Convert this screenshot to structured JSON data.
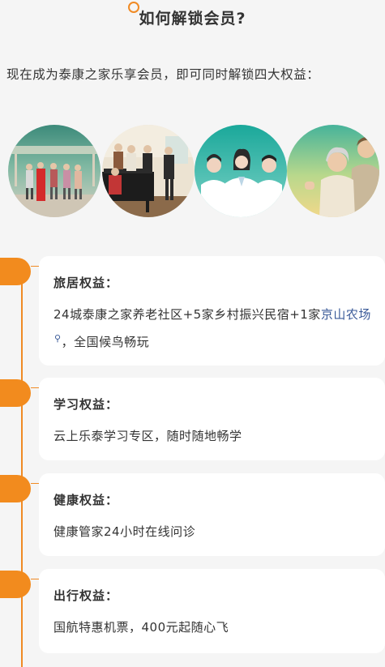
{
  "header": {
    "title": "如何解锁会员?"
  },
  "intro": "现在成为泰康之家乐享会员，即可同时解锁四大权益：",
  "photos": [
    {
      "name": "dancing-elders-photo"
    },
    {
      "name": "piano-choir-photo"
    },
    {
      "name": "medical-staff-photo"
    },
    {
      "name": "happy-couple-photo"
    }
  ],
  "benefits": [
    {
      "title": "旅居权益：",
      "text_before": "24城泰康之家养老社区+5家乡村振兴民宿+1家",
      "link": "京山农场",
      "text_after": "，全国候鸟畅玩"
    },
    {
      "title": "学习权益：",
      "text": "云上乐泰学习专区，随时随地畅学"
    },
    {
      "title": "健康权益：",
      "text": "健康管家24小时在线问诊"
    },
    {
      "title": "出行权益：",
      "text": "国航特惠机票，400元起随心飞"
    }
  ],
  "colors": {
    "accent": "#f28b1e",
    "link": "#3a5a98",
    "background": "#f5f5f5",
    "card": "#ffffff"
  }
}
